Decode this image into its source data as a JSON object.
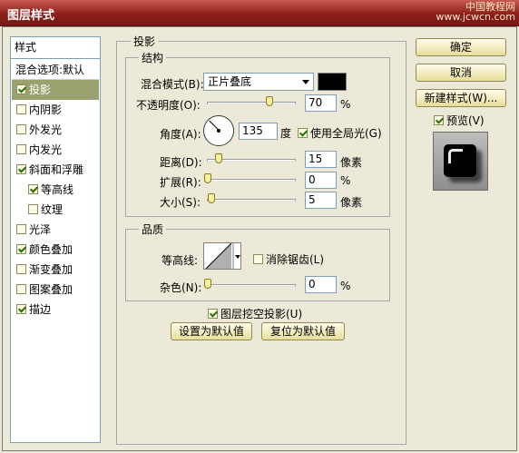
{
  "window": {
    "title": "图层样式",
    "watermark_line1": "中国教程网",
    "watermark_line2": "www.jcwcn.com"
  },
  "styles_list": {
    "header": "样式",
    "blending_options": "混合选项:默认",
    "items": [
      {
        "label": "投影",
        "checked": true,
        "selected": true
      },
      {
        "label": "内阴影",
        "checked": false
      },
      {
        "label": "外发光",
        "checked": false
      },
      {
        "label": "内发光",
        "checked": false
      },
      {
        "label": "斜面和浮雕",
        "checked": true
      },
      {
        "label": "等高线",
        "checked": true,
        "sub": true
      },
      {
        "label": "纹理",
        "checked": false,
        "sub": true
      },
      {
        "label": "光泽",
        "checked": false
      },
      {
        "label": "颜色叠加",
        "checked": true
      },
      {
        "label": "渐变叠加",
        "checked": false
      },
      {
        "label": "图案叠加",
        "checked": false
      },
      {
        "label": "描边",
        "checked": true
      }
    ]
  },
  "drop_shadow": {
    "group_title": "投影",
    "structure": {
      "title": "结构",
      "blend_mode_label": "混合模式(B):",
      "blend_mode_value": "正片叠底",
      "shadow_color": "#000000",
      "opacity_label": "不透明度(O):",
      "opacity_value": "70",
      "opacity_unit": "%",
      "opacity_level": 0.7,
      "angle_label": "角度(A):",
      "angle_value": "135",
      "angle_unit": "度",
      "global_light_label": "使用全局光(G)",
      "global_light_checked": true,
      "distance_label": "距离(D):",
      "distance_value": "15",
      "distance_unit": "像素",
      "spread_label": "扩展(R):",
      "spread_value": "0",
      "spread_unit": "%",
      "size_label": "大小(S):",
      "size_value": "5",
      "size_unit": "像素"
    },
    "quality": {
      "title": "品质",
      "contour_label": "等高线:",
      "anti_alias_label": "消除锯齿(L)",
      "anti_alias_checked": false,
      "noise_label": "杂色(N):",
      "noise_value": "0",
      "noise_unit": "%"
    },
    "knockout_label": "图层挖空投影(U)",
    "knockout_checked": true,
    "make_default_label": "设置为默认值",
    "reset_default_label": "复位为默认值"
  },
  "actions": {
    "ok_label": "确定",
    "cancel_label": "取消",
    "new_style_label": "新建样式(W)...",
    "preview_label": "预览(V)",
    "preview_checked": true
  }
}
